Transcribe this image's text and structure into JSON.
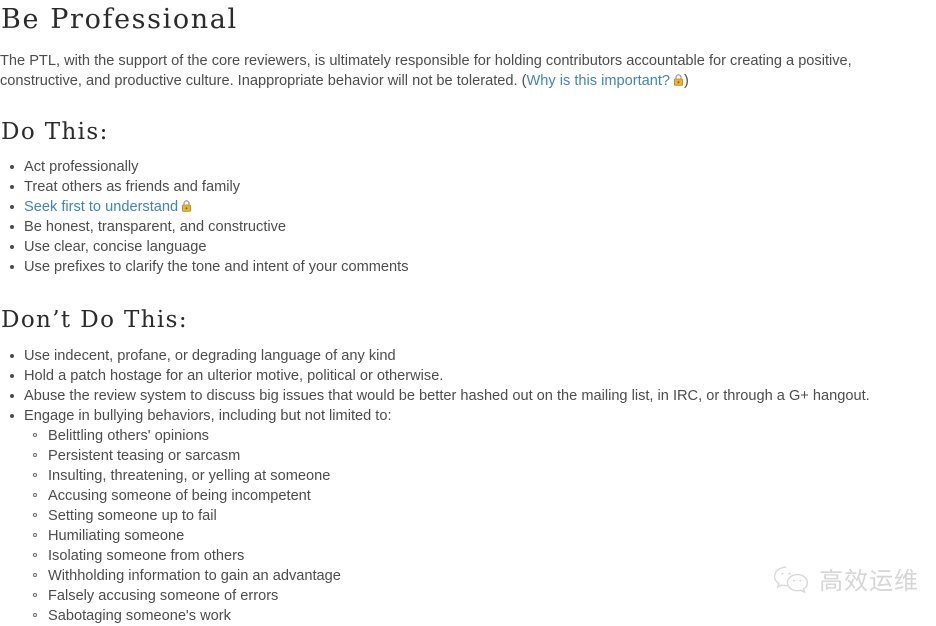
{
  "document": {
    "title": "Be Professional",
    "intro": {
      "text_before_link": "The PTL, with the support of the core reviewers, is ultimately responsible for holding contributors accountable for creating a positive, constructive, and productive culture. Inappropriate behavior will not be tolerated. (",
      "link_label": "Why is this important?",
      "link_icon": "lock-icon",
      "text_after_link": ")"
    },
    "sections": [
      {
        "heading": "Do This:",
        "items": [
          {
            "text": "Act professionally",
            "is_link": false,
            "has_lock": false
          },
          {
            "text": "Treat others as friends and family",
            "is_link": false,
            "has_lock": false
          },
          {
            "text": "Seek first to understand",
            "is_link": true,
            "has_lock": true
          },
          {
            "text": "Be honest, transparent, and constructive",
            "is_link": false,
            "has_lock": false
          },
          {
            "text": "Use clear, concise language",
            "is_link": false,
            "has_lock": false
          },
          {
            "text": "Use prefixes to clarify the tone and intent of your comments",
            "is_link": false,
            "has_lock": false
          }
        ]
      },
      {
        "heading": "Don’t Do This:",
        "items": [
          {
            "text": "Use indecent, profane, or degrading language of any kind",
            "is_link": false,
            "has_lock": false
          },
          {
            "text": "Hold a patch hostage for an ulterior motive, political or otherwise.",
            "is_link": false,
            "has_lock": false
          },
          {
            "text": "Abuse the review system to discuss big issues that would be better hashed out on the mailing list, in IRC, or through a G+ hangout.",
            "is_link": false,
            "has_lock": false
          },
          {
            "text": "Engage in bullying behaviors, including but not limited to:",
            "is_link": false,
            "has_lock": false
          }
        ],
        "sub_items": [
          "Belittling others' opinions",
          "Persistent teasing or sarcasm",
          "Insulting, threatening, or yelling at someone",
          "Accusing someone of being incompetent",
          "Setting someone up to fail",
          "Humiliating someone",
          "Isolating someone from others",
          "Withholding information to gain an advantage",
          "Falsely accusing someone of errors",
          "Sabotaging someone's work"
        ]
      }
    ]
  },
  "watermark": {
    "icon": "wechat-logo-icon",
    "text": "高效运维"
  },
  "colors": {
    "link": "#4185b4",
    "body_text": "#4c4c4c",
    "heading_text": "#2b2b2b",
    "lock_body": "#e8b52c",
    "lock_shackle": "#9a9a9a",
    "watermark_text": "#d6d6d6",
    "background": "#ffffff"
  }
}
